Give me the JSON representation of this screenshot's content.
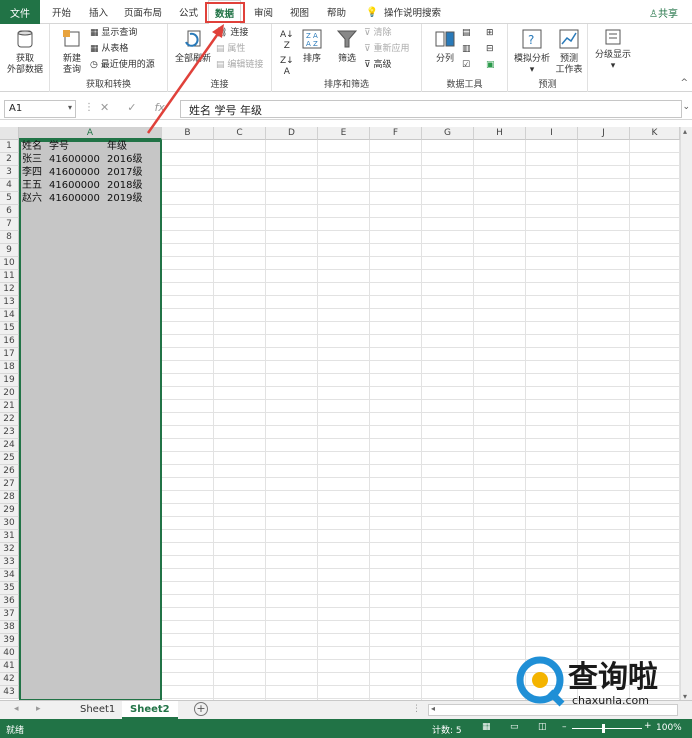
{
  "menu": {
    "file": "文件",
    "tabs": [
      "开始",
      "插入",
      "页面布局",
      "公式",
      "数据",
      "审阅",
      "视图",
      "帮助"
    ],
    "active_tab": "数据",
    "tell_me": "操作说明搜索",
    "share": "共享"
  },
  "ribbon": {
    "get_external": "获取\n外部数据",
    "new_query": "新建\n查询",
    "show_queries": "显示查询",
    "from_table": "从表格",
    "recent_sources": "最近使用的源",
    "group_get_transform": "获取和转换",
    "refresh_all": "全部刷新",
    "connections": "连接",
    "properties": "属性",
    "edit_links": "编辑链接",
    "group_connections": "连接",
    "sort": "排序",
    "filter": "筛选",
    "clear": "清除",
    "reapply": "重新应用",
    "advanced": "高级",
    "group_sort_filter": "排序和筛选",
    "text_to_columns": "分列",
    "group_data_tools": "数据工具",
    "what_if": "模拟分析",
    "forecast_sheet": "预测\n工作表",
    "group_forecast": "预测",
    "outline": "分级显示"
  },
  "formula_bar": {
    "name_box": "A1",
    "content": "姓名 学号    年级"
  },
  "columns": [
    "A",
    "B",
    "C",
    "D",
    "E",
    "F",
    "G",
    "H",
    "I",
    "J",
    "K"
  ],
  "rows_count": 43,
  "cells": [
    [
      "姓名",
      "学号",
      "年级"
    ],
    [
      "张三",
      "41600000",
      "2016级"
    ],
    [
      "李四",
      "41600000",
      "2017级"
    ],
    [
      "王五",
      "41600000",
      "2018级"
    ],
    [
      "赵六",
      "41600000",
      "2019级"
    ]
  ],
  "sheets": [
    "Sheet1",
    "Sheet2"
  ],
  "active_sheet": "Sheet2",
  "status": {
    "ready": "就绪",
    "count": "计数: 5",
    "zoom": "100%"
  },
  "watermark": {
    "text": "查询啦",
    "url": "chaxunla.com"
  },
  "colors": {
    "accent": "#217346",
    "highlight": "#e0413a"
  }
}
